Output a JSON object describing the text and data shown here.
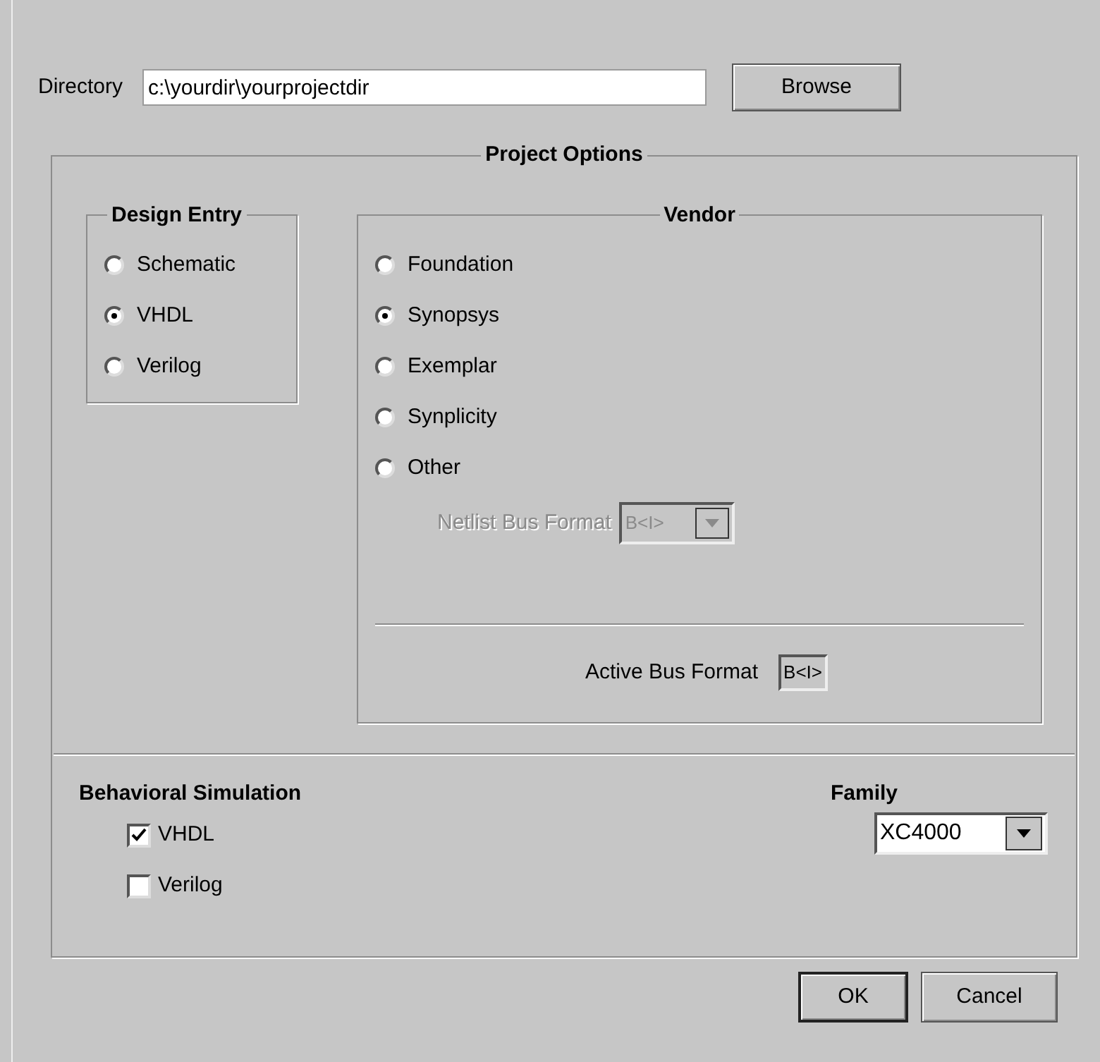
{
  "directory": {
    "label": "Directory",
    "value": "c:\\yourdir\\yourprojectdir"
  },
  "browse_button": "Browse",
  "project_options": {
    "title": "Project Options",
    "design_entry": {
      "title": "Design Entry",
      "options": [
        {
          "label": "Schematic",
          "selected": false
        },
        {
          "label": "VHDL",
          "selected": true
        },
        {
          "label": "Verilog",
          "selected": false
        }
      ]
    },
    "vendor": {
      "title": "Vendor",
      "options": [
        {
          "label": "Foundation",
          "selected": false
        },
        {
          "label": "Synopsys",
          "selected": true
        },
        {
          "label": "Exemplar",
          "selected": false
        },
        {
          "label": "Synplicity",
          "selected": false
        },
        {
          "label": "Other",
          "selected": false
        }
      ],
      "netlist_bus_format": {
        "label": "Netlist Bus Format",
        "value": "B<I>",
        "disabled": true
      },
      "active_bus_format": {
        "label": "Active Bus Format",
        "value": "B<I>"
      }
    },
    "behavioral_simulation": {
      "title": "Behavioral Simulation",
      "options": [
        {
          "label": "VHDL",
          "checked": true
        },
        {
          "label": "Verilog",
          "checked": false
        }
      ]
    },
    "family": {
      "label": "Family",
      "value": "XC4000"
    }
  },
  "buttons": [
    "OK",
    "Cancel"
  ]
}
